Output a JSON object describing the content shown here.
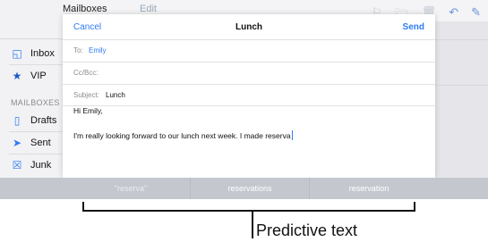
{
  "background_app": {
    "title": "Mailboxes",
    "edit_label": "Edit",
    "sidebar": {
      "inbox_label": "Inbox",
      "vip_label": "VIP",
      "section_heading": "MAILBOXES",
      "drafts_label": "Drafts",
      "sent_label": "Sent",
      "junk_label": "Junk"
    },
    "toolbar_icons": [
      "flag-icon",
      "folder-icon",
      "trash-icon",
      "reply-icon",
      "compose-icon"
    ]
  },
  "compose": {
    "cancel_label": "Cancel",
    "title": "Lunch",
    "send_label": "Send",
    "to_label": "To:",
    "to_value": "Emily",
    "ccbcc_label": "Cc/Bcc:",
    "subject_label": "Subject:",
    "subject_value": "Lunch",
    "body_line1": "Hi Emily,",
    "body_line2": "I'm really looking forward to our lunch next week. I made reserva"
  },
  "predictive_bar": {
    "suggestions": [
      "\"reserva\"",
      "reservations",
      "reservation"
    ]
  },
  "annotation": {
    "label": "Predictive text"
  },
  "colors": {
    "accent": "#2f7bf5",
    "keyboard_bar": "#c4c8ce"
  }
}
